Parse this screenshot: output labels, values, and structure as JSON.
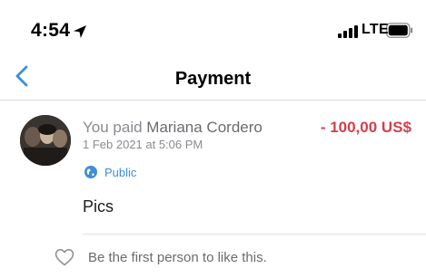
{
  "status_bar": {
    "time": "4:54",
    "network": "LTE",
    "icons": [
      "location-arrow-icon",
      "signal-bars-icon",
      "battery-icon"
    ]
  },
  "nav": {
    "title": "Payment",
    "back_icon": "chevron-left-icon"
  },
  "payment": {
    "prefix": "You paid ",
    "payee": "Mariana Cordero",
    "amount": "- 100,00 US$",
    "date": "1 Feb 2021 at 5:06 PM",
    "visibility": "Public",
    "visibility_icon": "globe-icon",
    "note": "Pics"
  },
  "social": {
    "like_icon": "heart-outline-icon",
    "like_text": "Be the first person to like this."
  },
  "colors": {
    "accent": "#3d8fd6",
    "amount_negative": "#d33f4c",
    "secondary_text": "#8a8a90",
    "divider": "#e1e1e6"
  }
}
